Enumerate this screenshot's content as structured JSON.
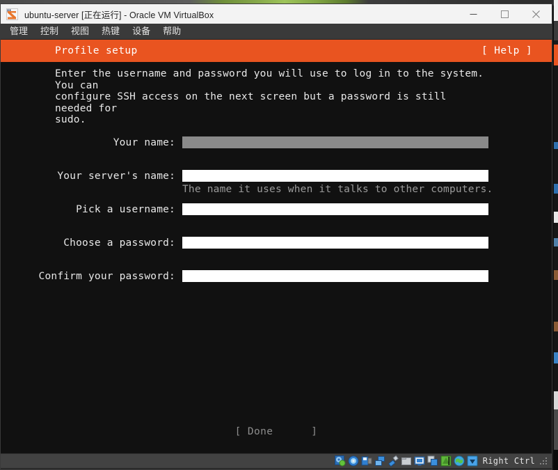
{
  "window": {
    "title": "ubuntu-server [正在运行] - Oracle VM VirtualBox",
    "logo_icon": "virtualbox-logo-icon",
    "controls": [
      {
        "name": "minimize-button",
        "icon": "minimize-icon",
        "label": "—"
      },
      {
        "name": "maximize-button",
        "icon": "maximize-icon",
        "label": "□"
      },
      {
        "name": "close-button",
        "icon": "close-icon",
        "label": "✕"
      }
    ]
  },
  "menubar": {
    "items": [
      {
        "label": "管理"
      },
      {
        "label": "控制"
      },
      {
        "label": "视图"
      },
      {
        "label": "热键"
      },
      {
        "label": "设备"
      },
      {
        "label": "帮助"
      }
    ]
  },
  "installer": {
    "header": {
      "title": "Profile setup",
      "help": "[ Help ]",
      "bg_color": "#e95420",
      "fg_color": "#ffffff"
    },
    "intro": "Enter the username and password you will use to log in to the system. You can\nconfigure SSH access on the next screen but a password is still needed for\nsudo.",
    "fields": [
      {
        "label": "Your name:",
        "value": "",
        "hint": "",
        "focused": true,
        "name": "your-name-input"
      },
      {
        "label": "Your server's name:",
        "value": "",
        "hint": "The name it uses when it talks to other computers.",
        "focused": false,
        "name": "server-name-input"
      },
      {
        "label": "Pick a username:",
        "value": "",
        "hint": "",
        "focused": false,
        "name": "username-input"
      },
      {
        "label": "Choose a password:",
        "value": "",
        "hint": "",
        "focused": false,
        "name": "password-input"
      },
      {
        "label": "Confirm your password:",
        "value": "",
        "hint": "",
        "focused": false,
        "name": "confirm-password-input"
      }
    ],
    "done_button": "[ Done      ]",
    "terminal_bg": "#111111",
    "terminal_fg": "#e8e8e8"
  },
  "statusbar": {
    "icons": [
      {
        "name": "hard-disk-icon"
      },
      {
        "name": "optical-drive-icon"
      },
      {
        "name": "floppy-drive-icon"
      },
      {
        "name": "network-icon"
      },
      {
        "name": "usb-icon"
      },
      {
        "name": "shared-folders-icon"
      },
      {
        "name": "display-icon"
      },
      {
        "name": "shared-clipboard-icon"
      },
      {
        "name": "recording-icon"
      },
      {
        "name": "guest-additions-icon"
      },
      {
        "name": "mouse-integration-icon"
      }
    ],
    "host_key": "Right Ctrl"
  }
}
